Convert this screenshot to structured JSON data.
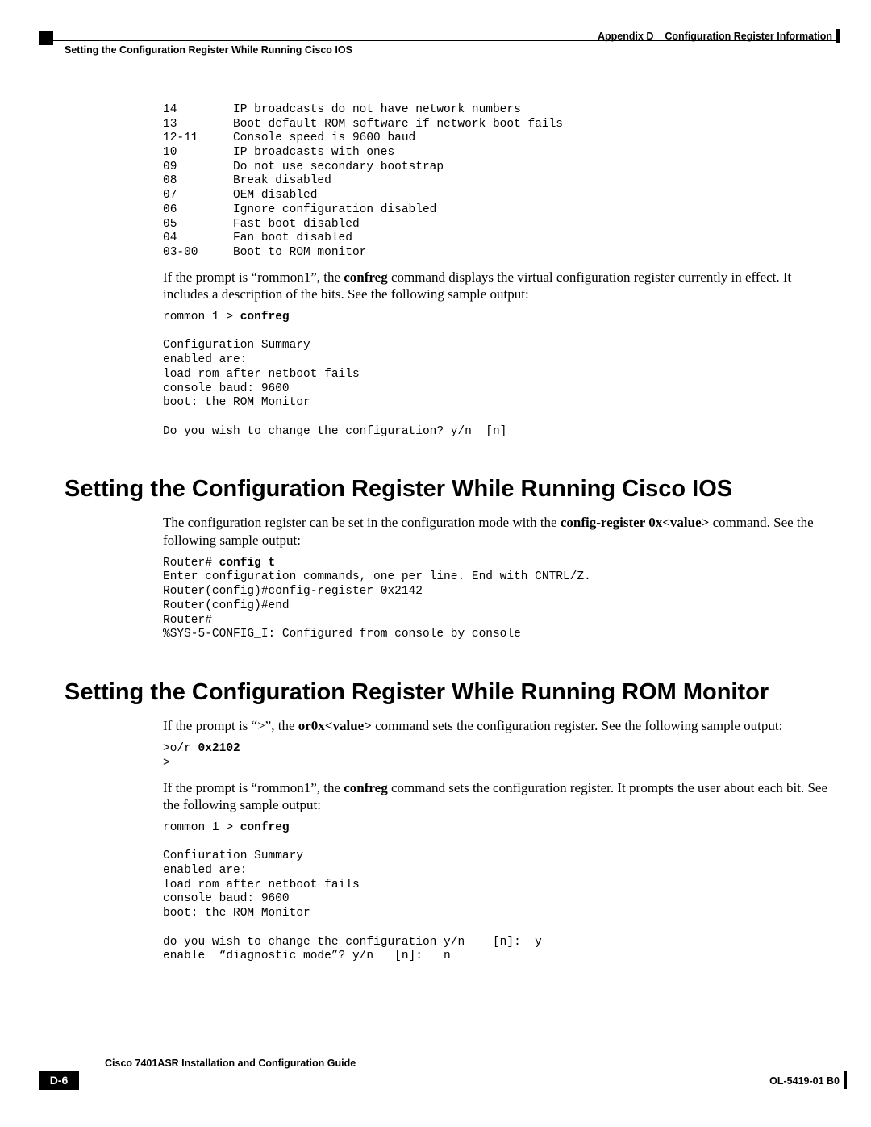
{
  "header": {
    "appendix_label": "Appendix D",
    "appendix_title": "Configuration Register Information",
    "section_title": "Setting the Configuration Register While Running Cisco IOS"
  },
  "bits_table": [
    {
      "bit": "14",
      "desc": "IP broadcasts do not have network numbers"
    },
    {
      "bit": "13",
      "desc": "Boot default ROM software if network boot fails"
    },
    {
      "bit": "12-11",
      "desc": "Console speed is 9600 baud"
    },
    {
      "bit": "10",
      "desc": "IP broadcasts with ones"
    },
    {
      "bit": "09",
      "desc": "Do not use secondary bootstrap"
    },
    {
      "bit": "08",
      "desc": "Break disabled"
    },
    {
      "bit": "07",
      "desc": "OEM disabled"
    },
    {
      "bit": "06",
      "desc": "Ignore configuration disabled"
    },
    {
      "bit": "05",
      "desc": "Fast boot disabled"
    },
    {
      "bit": "04",
      "desc": "Fan boot disabled"
    },
    {
      "bit": "03-00",
      "desc": "Boot to ROM monitor"
    }
  ],
  "para1_a": "If the prompt is “rommon1”, the ",
  "para1_bold": "confreg",
  "para1_b": " command displays the virtual configuration register currently in effect. It includes a description of the bits. See the following sample output:",
  "block1_prefix": "rommon 1 > ",
  "block1_cmd": "confreg",
  "block1_rest": "\n\nConfiguration Summary\nenabled are:\nload rom after netboot fails\nconsole baud: 9600\nboot: the ROM Monitor\n\nDo you wish to change the configuration? y/n  [n]",
  "heading1": "Setting the Configuration Register While Running Cisco IOS",
  "para2_a": "The configuration register can be set in the configuration mode with the ",
  "para2_bold1": "config-register 0x",
  "para2_mid": "<value>",
  "para2_b": " command. See the following sample output:",
  "block2_prefix": "Router# ",
  "block2_cmd": "config t",
  "block2_rest": "\nEnter configuration commands, one per line. End with CNTRL/Z.\nRouter(config)#config-register 0x2142\nRouter(config)#end\nRouter#\n%SYS-5-CONFIG_I: Configured from console by console",
  "heading2": "Setting the Configuration Register While Running ROM Monitor",
  "para3_a": "If the prompt is “>”, the ",
  "para3_bold1": "or0x",
  "para3_mid": "<value>",
  "para3_b": " command sets the configuration register. See the following sample output:",
  "block3_prefix": ">o/r ",
  "block3_cmd": "0x2102",
  "block3_rest": "\n>",
  "para4_a": "If the prompt is “rommon1”, the ",
  "para4_bold": "confreg",
  "para4_b": " command sets the configuration register. It prompts the user about each bit. See the following sample output:",
  "block4_prefix": "rommon 1 > ",
  "block4_cmd": "confreg",
  "block4_rest": "\n\nConfiuration Summary\nenabled are:\nload rom after netboot fails\nconsole baud: 9600\nboot: the ROM Monitor\n\ndo you wish to change the configuration y/n    [n]:  y\nenable  “diagnostic mode”? y/n   [n]:   n",
  "footer": {
    "guide": "Cisco 7401ASR Installation and Configuration Guide",
    "page": "D-6",
    "docnum": "OL-5419-01 B0"
  }
}
